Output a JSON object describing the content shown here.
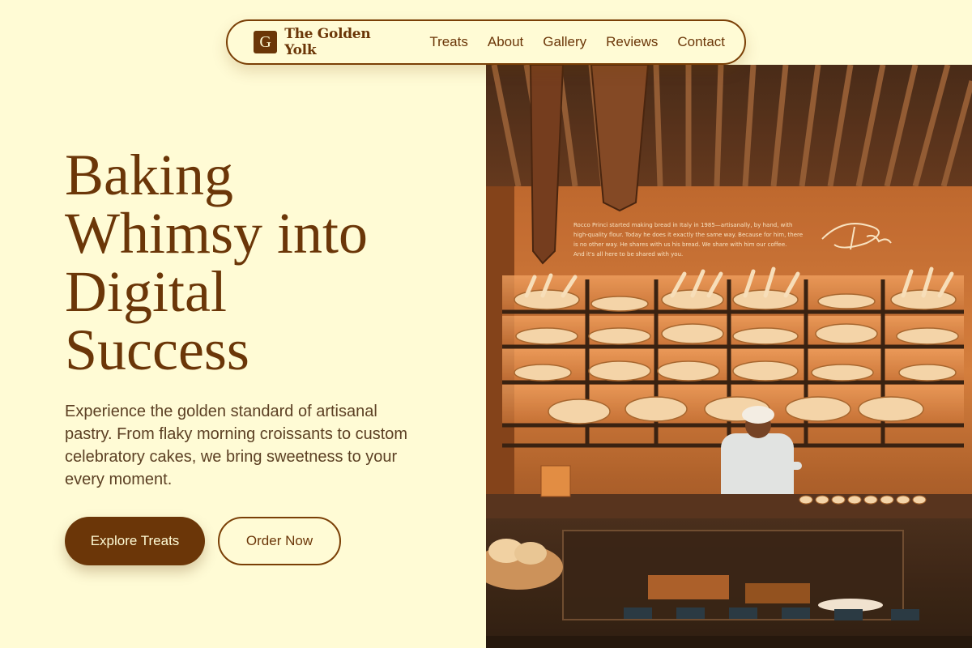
{
  "brand": {
    "logo_letter": "G",
    "name": "The Golden Yolk"
  },
  "nav": {
    "links": [
      "Treats",
      "About",
      "Gallery",
      "Reviews",
      "Contact"
    ]
  },
  "hero": {
    "headline_lines": [
      "Baking",
      "Whimsy into",
      "Digital",
      "Success"
    ],
    "lead": "Experience the golden standard of artisanal pastry. From flaky morning croissants to custom celebratory cakes, we bring sweetness to your every moment.",
    "primary_cta": "Explore Treats",
    "secondary_cta": "Order Now"
  },
  "image": {
    "alt": "Bakery counter with shelves of bread and a baker",
    "wall_text": [
      "Rocco Princi started making bread in Italy in 1985—artisanally, by hand, with",
      "high-quality flour. Today he does it exactly the same way. Because for him, there",
      "is no other way. He shares with us his bread. We share with him our coffee.",
      "And it's all here to be shared with you."
    ],
    "signature": "Princi"
  },
  "colors": {
    "background": "#fffbd5",
    "brand_brown": "#6b3608",
    "text_muted": "#5c4024"
  }
}
